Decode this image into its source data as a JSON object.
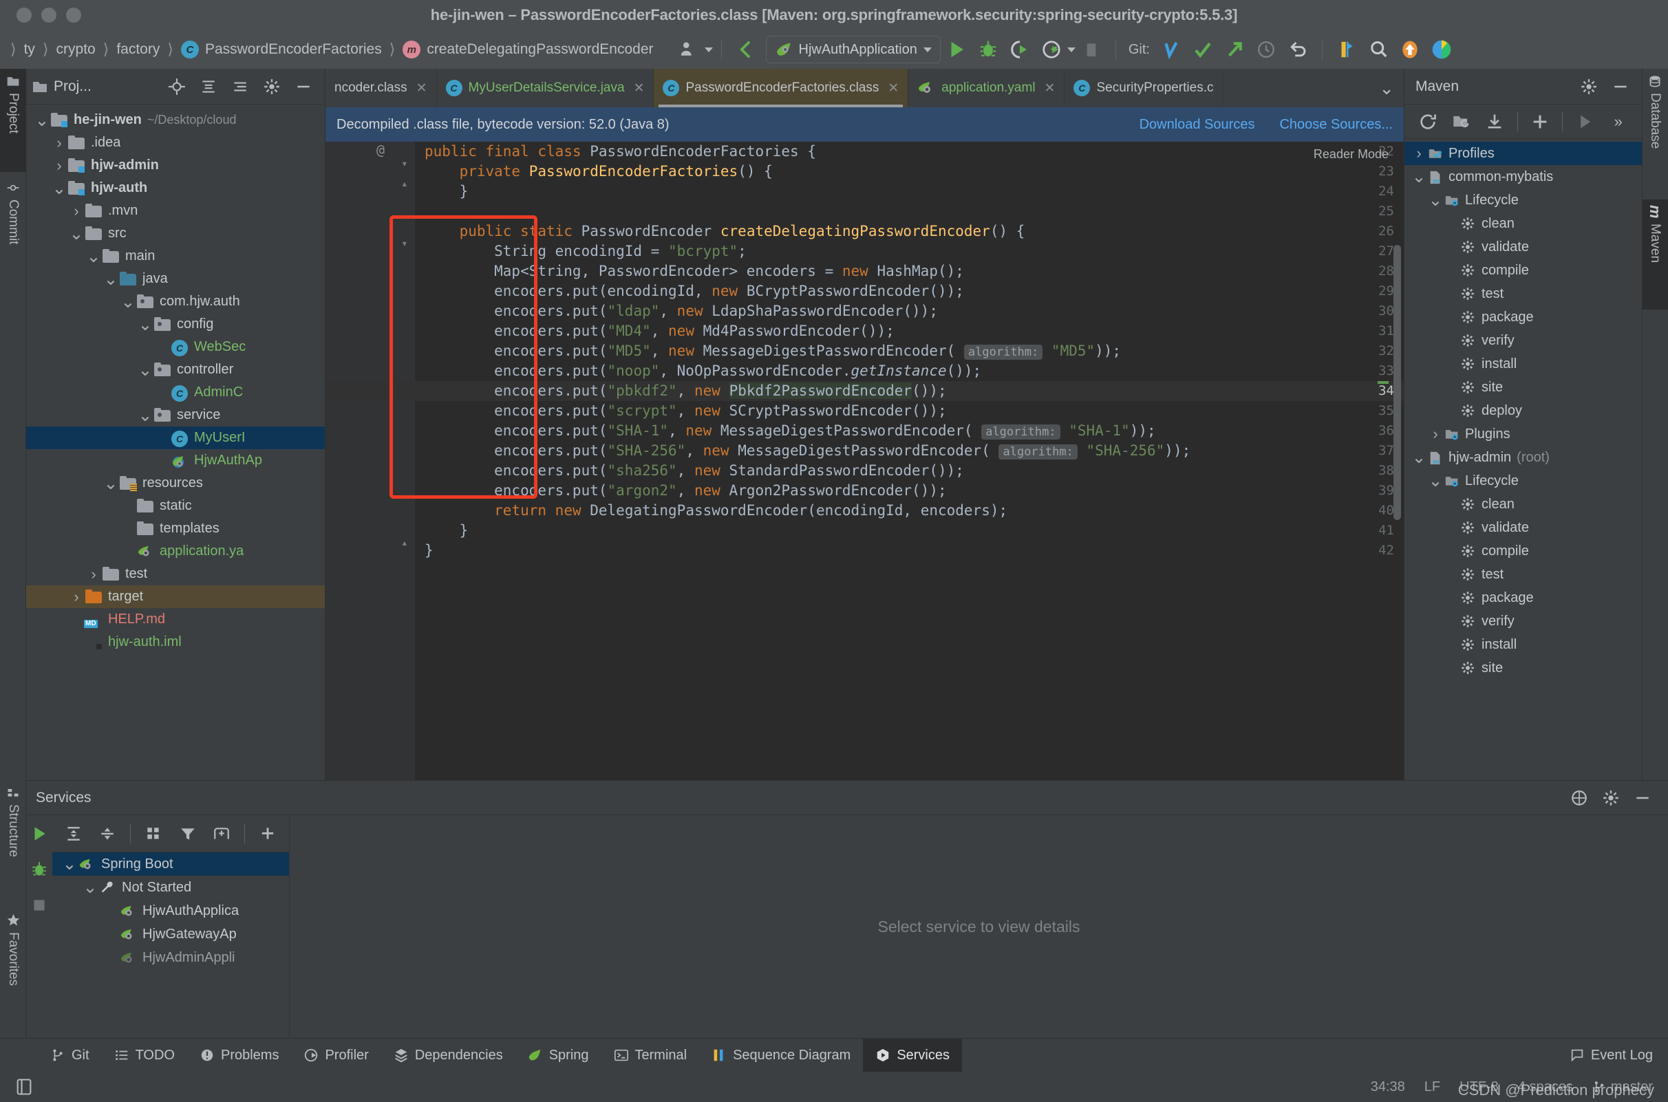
{
  "window": {
    "title": "he-jin-wen – PasswordEncoderFactories.class [Maven: org.springframework.security:spring-security-crypto:5.5.3]"
  },
  "breadcrumbs": [
    {
      "label": "ty",
      "icon": "none"
    },
    {
      "label": "crypto",
      "icon": "none"
    },
    {
      "label": "factory",
      "icon": "none"
    },
    {
      "label": "PasswordEncoderFactories",
      "icon": "class-icon"
    },
    {
      "label": "createDelegatingPasswordEncoder",
      "icon": "method-icon"
    }
  ],
  "toolbar": {
    "run_config": "HjwAuthApplication",
    "git_label": "Git:",
    "icons": [
      "user-icon",
      "back-arrow-icon",
      "run-icon",
      "debug-icon",
      "run-with-coverage-icon",
      "profiler-icon",
      "stop-icon",
      "git-update-icon",
      "git-commit-icon",
      "git-push-icon",
      "history-icon",
      "rollback-icon",
      "bookmark-icon",
      "search-everywhere-icon",
      "update-icon",
      "ide-icon"
    ]
  },
  "left_tabs": [
    {
      "label": "Project",
      "icon": "project-icon",
      "selected": true
    },
    {
      "label": "Commit",
      "icon": "commit-icon",
      "selected": false
    },
    {
      "label": "Structure",
      "icon": "structure-icon",
      "selected": false
    },
    {
      "label": "Favorites",
      "icon": "star-icon",
      "selected": false
    }
  ],
  "right_tabs": [
    {
      "label": "Database",
      "icon": "database-icon",
      "selected": false
    },
    {
      "label": "Maven",
      "icon": "maven-m-icon",
      "selected": true
    }
  ],
  "project_panel": {
    "title": "Proj...",
    "header_icons": [
      "locate-icon",
      "collapse-all-icon",
      "expand-icon",
      "settings-icon",
      "hide-icon"
    ],
    "tree": [
      {
        "depth": 0,
        "arrow": "v",
        "icon": "module-folder",
        "label": "he-jin-wen",
        "suffix": "~/Desktop/cloud",
        "bold": true,
        "color": "normal"
      },
      {
        "depth": 1,
        "arrow": ">",
        "icon": "folder",
        "label": ".idea",
        "color": "normal"
      },
      {
        "depth": 1,
        "arrow": ">",
        "icon": "module-folder",
        "label": "hjw-admin",
        "bold": true,
        "color": "normal"
      },
      {
        "depth": 1,
        "arrow": "v",
        "icon": "module-folder",
        "label": "hjw-auth",
        "bold": true,
        "color": "normal"
      },
      {
        "depth": 2,
        "arrow": ">",
        "icon": "folder",
        "label": ".mvn",
        "color": "normal"
      },
      {
        "depth": 2,
        "arrow": "v",
        "icon": "folder",
        "label": "src",
        "color": "normal"
      },
      {
        "depth": 3,
        "arrow": "v",
        "icon": "folder",
        "label": "main",
        "color": "normal"
      },
      {
        "depth": 4,
        "arrow": "v",
        "icon": "source-folder",
        "label": "java",
        "color": "normal"
      },
      {
        "depth": 5,
        "arrow": "v",
        "icon": "package",
        "label": "com.hjw.auth",
        "color": "normal"
      },
      {
        "depth": 6,
        "arrow": "v",
        "icon": "package",
        "label": "config",
        "color": "normal"
      },
      {
        "depth": 7,
        "arrow": "",
        "icon": "class",
        "label": "WebSec",
        "color": "green"
      },
      {
        "depth": 6,
        "arrow": "v",
        "icon": "package",
        "label": "controller",
        "color": "normal"
      },
      {
        "depth": 7,
        "arrow": "",
        "icon": "class",
        "label": "AdminC",
        "color": "green"
      },
      {
        "depth": 6,
        "arrow": "v",
        "icon": "package",
        "label": "service",
        "color": "normal"
      },
      {
        "depth": 7,
        "arrow": "",
        "icon": "class",
        "label": "MyUserI",
        "color": "green",
        "selected": "blue"
      },
      {
        "depth": 7,
        "arrow": "",
        "icon": "spring-class",
        "label": "HjwAuthAp",
        "color": "green"
      },
      {
        "depth": 4,
        "arrow": "v",
        "icon": "resources-folder",
        "label": "resources",
        "color": "normal"
      },
      {
        "depth": 5,
        "arrow": "",
        "icon": "folder",
        "label": "static",
        "color": "normal"
      },
      {
        "depth": 5,
        "arrow": "",
        "icon": "folder",
        "label": "templates",
        "color": "normal"
      },
      {
        "depth": 5,
        "arrow": "",
        "icon": "spring-yaml",
        "label": "application.ya",
        "color": "green"
      },
      {
        "depth": 3,
        "arrow": ">",
        "icon": "folder",
        "label": "test",
        "color": "normal"
      },
      {
        "depth": 2,
        "arrow": ">",
        "icon": "target-folder",
        "label": "target",
        "color": "normal",
        "selected": "brown"
      },
      {
        "depth": 2,
        "arrow": "",
        "icon": "md-file",
        "label": "HELP.md",
        "color": "red"
      },
      {
        "depth": 2,
        "arrow": "",
        "icon": "iml-file",
        "label": "hjw-auth.iml",
        "color": "green"
      }
    ]
  },
  "editor": {
    "tabs": [
      {
        "label": "ncoder.class",
        "icon": "class-icon",
        "active": false,
        "truncated": true
      },
      {
        "label": "MyUserDetailsService.java",
        "icon": "class-icon",
        "active": false,
        "color": "green"
      },
      {
        "label": "PasswordEncoderFactories.class",
        "icon": "class-icon",
        "active": true
      },
      {
        "label": "application.yaml",
        "icon": "spring-icon",
        "active": false,
        "color": "green"
      },
      {
        "label": "SecurityProperties.c",
        "icon": "class-icon",
        "active": false
      }
    ],
    "notice": {
      "text": "Decompiled .class file, bytecode version: 52.0 (Java 8)",
      "link_download": "Download Sources",
      "link_choose": "Choose Sources..."
    },
    "reader_mode": "Reader Mode",
    "first_line": 22,
    "current_line": 34,
    "lines": [
      {
        "n": 22,
        "code": "public final class PasswordEncoderFactories {"
      },
      {
        "n": 23,
        "code": "    private PasswordEncoderFactories() {"
      },
      {
        "n": 24,
        "code": "    }"
      },
      {
        "n": 25,
        "code": ""
      },
      {
        "n": 26,
        "code": "    public static PasswordEncoder createDelegatingPasswordEncoder() {"
      },
      {
        "n": 27,
        "code": "        String encodingId = \"bcrypt\";"
      },
      {
        "n": 28,
        "code": "        Map<String, PasswordEncoder> encoders = new HashMap();"
      },
      {
        "n": 29,
        "code": "        encoders.put(encodingId, new BCryptPasswordEncoder());"
      },
      {
        "n": 30,
        "code": "        encoders.put(\"ldap\", new LdapShaPasswordEncoder());"
      },
      {
        "n": 31,
        "code": "        encoders.put(\"MD4\", new Md4PasswordEncoder());"
      },
      {
        "n": 32,
        "code": "        encoders.put(\"MD5\", new MessageDigestPasswordEncoder( algorithm: \"MD5\"));"
      },
      {
        "n": 33,
        "code": "        encoders.put(\"noop\", NoOpPasswordEncoder.getInstance());"
      },
      {
        "n": 34,
        "code": "        encoders.put(\"pbkdf2\", new Pbkdf2PasswordEncoder());"
      },
      {
        "n": 35,
        "code": "        encoders.put(\"scrypt\", new SCryptPasswordEncoder());"
      },
      {
        "n": 36,
        "code": "        encoders.put(\"SHA-1\", new MessageDigestPasswordEncoder( algorithm: \"SHA-1\"));"
      },
      {
        "n": 37,
        "code": "        encoders.put(\"SHA-256\", new MessageDigestPasswordEncoder( algorithm: \"SHA-256\"));"
      },
      {
        "n": 38,
        "code": "        encoders.put(\"sha256\", new StandardPasswordEncoder());"
      },
      {
        "n": 39,
        "code": "        encoders.put(\"argon2\", new Argon2PasswordEncoder());"
      },
      {
        "n": 40,
        "code": "        return new DelegatingPasswordEncoder(encodingId, encoders);"
      },
      {
        "n": 41,
        "code": "    }"
      },
      {
        "n": 42,
        "code": "}"
      }
    ]
  },
  "maven_panel": {
    "title": "Maven",
    "toolbar_icons": [
      "reload-icon",
      "add-maven-project-icon",
      "download-sources-icon",
      "plus-icon",
      "run-icon",
      "more-icon"
    ],
    "header_icons": [
      "settings-icon",
      "hide-icon"
    ],
    "tree": [
      {
        "depth": 0,
        "arrow": ">",
        "icon": "profiles-icon",
        "label": "Profiles",
        "selected": true
      },
      {
        "depth": 0,
        "arrow": "v",
        "icon": "maven-module-icon",
        "label": "common-mybatis"
      },
      {
        "depth": 1,
        "arrow": "v",
        "icon": "lifecycle-folder-icon",
        "label": "Lifecycle"
      },
      {
        "depth": 2,
        "arrow": "",
        "icon": "gear-icon",
        "label": "clean"
      },
      {
        "depth": 2,
        "arrow": "",
        "icon": "gear-icon",
        "label": "validate"
      },
      {
        "depth": 2,
        "arrow": "",
        "icon": "gear-icon",
        "label": "compile"
      },
      {
        "depth": 2,
        "arrow": "",
        "icon": "gear-icon",
        "label": "test"
      },
      {
        "depth": 2,
        "arrow": "",
        "icon": "gear-icon",
        "label": "package"
      },
      {
        "depth": 2,
        "arrow": "",
        "icon": "gear-icon",
        "label": "verify"
      },
      {
        "depth": 2,
        "arrow": "",
        "icon": "gear-icon",
        "label": "install"
      },
      {
        "depth": 2,
        "arrow": "",
        "icon": "gear-icon",
        "label": "site"
      },
      {
        "depth": 2,
        "arrow": "",
        "icon": "gear-icon",
        "label": "deploy"
      },
      {
        "depth": 1,
        "arrow": ">",
        "icon": "plugins-folder-icon",
        "label": "Plugins"
      },
      {
        "depth": 0,
        "arrow": "v",
        "icon": "maven-module-icon",
        "label": "hjw-admin",
        "suffix": "(root)"
      },
      {
        "depth": 1,
        "arrow": "v",
        "icon": "lifecycle-folder-icon",
        "label": "Lifecycle"
      },
      {
        "depth": 2,
        "arrow": "",
        "icon": "gear-icon",
        "label": "clean"
      },
      {
        "depth": 2,
        "arrow": "",
        "icon": "gear-icon",
        "label": "validate"
      },
      {
        "depth": 2,
        "arrow": "",
        "icon": "gear-icon",
        "label": "compile"
      },
      {
        "depth": 2,
        "arrow": "",
        "icon": "gear-icon",
        "label": "test"
      },
      {
        "depth": 2,
        "arrow": "",
        "icon": "gear-icon",
        "label": "package"
      },
      {
        "depth": 2,
        "arrow": "",
        "icon": "gear-icon",
        "label": "verify"
      },
      {
        "depth": 2,
        "arrow": "",
        "icon": "gear-icon",
        "label": "install"
      },
      {
        "depth": 2,
        "arrow": "",
        "icon": "gear-icon",
        "label": "site"
      }
    ]
  },
  "services_panel": {
    "title": "Services",
    "header_icons": [
      "help-icon",
      "settings-icon",
      "hide-icon"
    ],
    "side_icons": [
      "run-icon",
      "debug-icon",
      "stop-icon"
    ],
    "toolbar_icons": [
      "expand-all-icon",
      "collapse-all-icon",
      "group-by-icon",
      "filter-icon",
      "add-tab-icon",
      "add-icon"
    ],
    "tree": [
      {
        "depth": 0,
        "arrow": "v",
        "icon": "spring-boot-icon",
        "label": "Spring Boot",
        "selected": true
      },
      {
        "depth": 1,
        "arrow": "v",
        "icon": "wrench-icon",
        "label": "Not Started"
      },
      {
        "depth": 2,
        "arrow": "",
        "icon": "spring-run-icon",
        "label": "HjwAuthApplica"
      },
      {
        "depth": 2,
        "arrow": "",
        "icon": "spring-run-icon",
        "label": "HjwGatewayAp"
      },
      {
        "depth": 2,
        "arrow": "",
        "icon": "spring-run-icon",
        "label": "HjwAdminAppli",
        "dim": true
      }
    ],
    "detail_placeholder": "Select service to view details"
  },
  "bottom_tools": [
    {
      "label": "Git",
      "icon": "git-icon",
      "active": false
    },
    {
      "label": "TODO",
      "icon": "todo-icon",
      "active": false
    },
    {
      "label": "Problems",
      "icon": "problems-icon",
      "active": false
    },
    {
      "label": "Profiler",
      "icon": "profiler-icon",
      "active": false
    },
    {
      "label": "Dependencies",
      "icon": "dependencies-icon",
      "active": false
    },
    {
      "label": "Spring",
      "icon": "spring-icon",
      "active": false
    },
    {
      "label": "Terminal",
      "icon": "terminal-icon",
      "active": false
    },
    {
      "label": "Sequence Diagram",
      "icon": "sequence-diagram-icon",
      "active": false
    },
    {
      "label": "Services",
      "icon": "services-icon",
      "active": true
    }
  ],
  "event_log": {
    "label": "Event Log",
    "icon": "event-log-icon"
  },
  "statusbar": {
    "caret": "34:38",
    "line_separator": "LF",
    "encoding": "UTF-8",
    "indent": "4 spaces",
    "branch": "master",
    "branch_icon": "branch-icon",
    "toggle_icon": "toggle-panel-icon"
  },
  "watermark": "CSDN @Prediction prophecy",
  "colors": {
    "accent_blue": "#3f9fc4",
    "selection_blue": "#0f3556",
    "notice_blue": "#2f4a6b",
    "link_blue": "#5aa9f0",
    "highlight_red": "#ef3b24",
    "green_text": "#78b96a",
    "keyword_orange": "#cc7832",
    "string_green": "#6a8759",
    "method_yellow": "#ffc66d",
    "editor_bg": "#2b2b2b",
    "panel_bg": "#3c3f41"
  }
}
